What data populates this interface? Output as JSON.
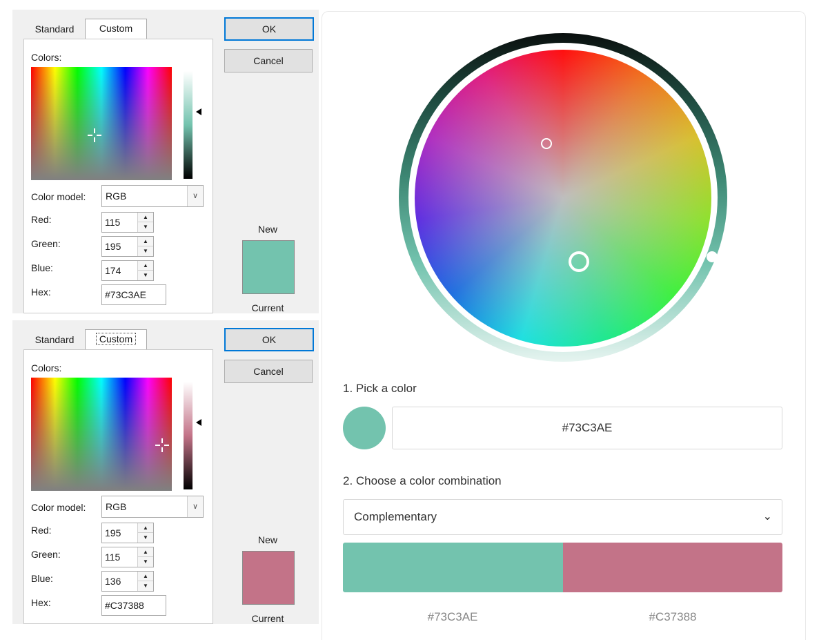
{
  "dialogs": [
    {
      "tabs": {
        "standard": "Standard",
        "custom": "Custom"
      },
      "colors_label": "Colors:",
      "color_model_label": "Color model:",
      "color_model_value": "RGB",
      "red_label": "Red:",
      "red_value": "115",
      "green_label": "Green:",
      "green_value": "195",
      "blue_label": "Blue:",
      "blue_value": "174",
      "hex_label": "Hex:",
      "hex_value": "#73C3AE",
      "ok_label": "OK",
      "cancel_label": "Cancel",
      "new_label": "New",
      "current_label": "Current",
      "swatch_color": "#73C3AE"
    },
    {
      "tabs": {
        "standard": "Standard",
        "custom": "Custom"
      },
      "colors_label": "Colors:",
      "color_model_label": "Color model:",
      "color_model_value": "RGB",
      "red_label": "Red:",
      "red_value": "195",
      "green_label": "Green:",
      "green_value": "115",
      "blue_label": "Blue:",
      "blue_value": "136",
      "hex_label": "Hex:",
      "hex_value": "#C37388",
      "ok_label": "OK",
      "cancel_label": "Cancel",
      "new_label": "New",
      "current_label": "Current",
      "swatch_color": "#C37388"
    }
  ],
  "picker": {
    "step1_label": "1. Pick a color",
    "selected_hex": "#73C3AE",
    "selected_color": "#73C3AE",
    "step2_label": "2. Choose a color combination",
    "combination": "Complementary",
    "palette": [
      {
        "hex": "#73C3AE",
        "color": "#73C3AE"
      },
      {
        "hex": "#C37388",
        "color": "#C37388"
      }
    ]
  },
  "icons": {
    "dropdown": "chevron-down-icon",
    "spin": "spin-arrows-icon"
  }
}
